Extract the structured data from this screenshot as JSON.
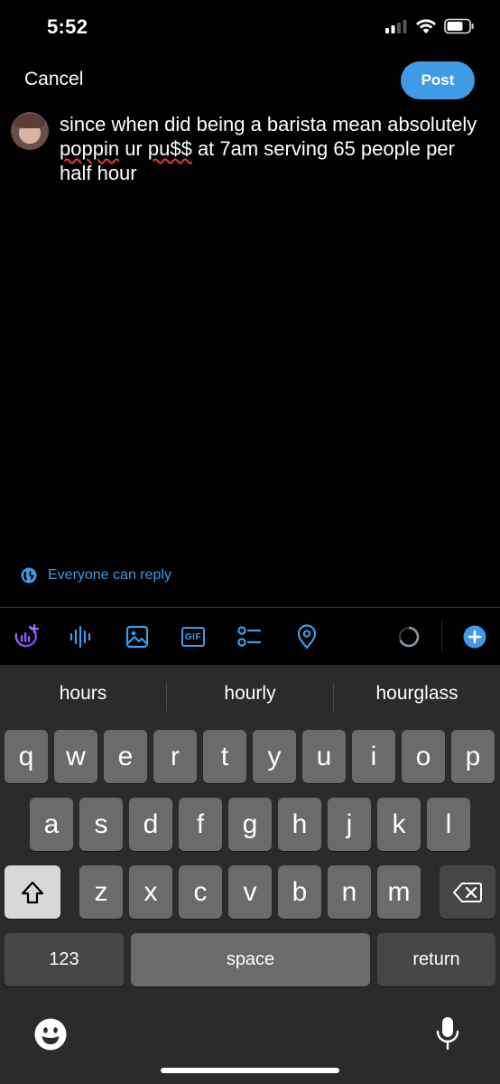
{
  "status": {
    "time": "5:52"
  },
  "header": {
    "cancel_label": "Cancel",
    "post_label": "Post"
  },
  "compose": {
    "text_part1": "since when did being a barista mean absolutely ",
    "misspelled1": "poppin",
    "text_part2": " ur ",
    "misspelled2": "pu$$",
    "text_part3": " at 7am serving 65 people per half hour"
  },
  "reply_setting": {
    "label": "Everyone can reply"
  },
  "toolbar": {
    "gif_label": "GIF"
  },
  "colors": {
    "accent": "#3f9be6",
    "background": "#000000",
    "keyboard": "#2b2b2b",
    "key": "#6b6b6b",
    "key_dark": "#464646"
  },
  "keyboard": {
    "suggestions": [
      "hours",
      "hourly",
      "hourglass"
    ],
    "row1": [
      "q",
      "w",
      "e",
      "r",
      "t",
      "y",
      "u",
      "i",
      "o",
      "p"
    ],
    "row2": [
      "a",
      "s",
      "d",
      "f",
      "g",
      "h",
      "j",
      "k",
      "l"
    ],
    "row3": [
      "z",
      "x",
      "c",
      "v",
      "b",
      "n",
      "m"
    ],
    "numbers_label": "123",
    "space_label": "space",
    "return_label": "return"
  }
}
